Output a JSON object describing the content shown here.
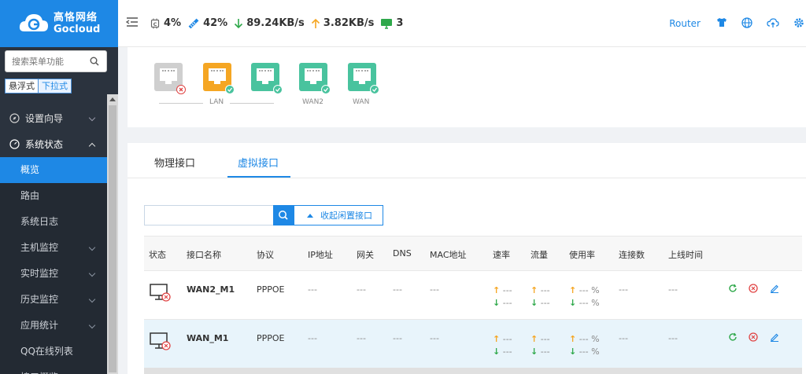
{
  "logo": {
    "cn": "高恪网络",
    "en": "Gocloud"
  },
  "sidebar": {
    "search_placeholder": "搜索菜单功能",
    "mode_floating": "悬浮式",
    "mode_dropdown": "下拉式",
    "items": [
      {
        "label": "设置向导"
      },
      {
        "label": "系统状态"
      }
    ],
    "subitems": [
      {
        "label": "概览"
      },
      {
        "label": "路由"
      },
      {
        "label": "系统日志"
      },
      {
        "label": "主机监控"
      },
      {
        "label": "实时监控"
      },
      {
        "label": "历史监控"
      },
      {
        "label": "应用统计"
      },
      {
        "label": "QQ在线列表"
      },
      {
        "label": "接口概览"
      }
    ]
  },
  "topbar": {
    "cpu": "4%",
    "mem": "42%",
    "down": "89.24KB/s",
    "up": "3.82KB/s",
    "clients": "3",
    "router_label": "Router"
  },
  "ports": {
    "lan_label": "LAN",
    "wan2_label": "WAN2",
    "wan_label": "WAN"
  },
  "tabs": {
    "physical": "物理接口",
    "virtual": "虚拟接口"
  },
  "filter": {
    "collapse_label": "收起闲置接口"
  },
  "table": {
    "headers": [
      "状态",
      "接口名称",
      "协议",
      "IP地址",
      "网关",
      "DNS",
      "MAC地址",
      "速率",
      "流量",
      "使用率",
      "连接数",
      "上线时间"
    ],
    "rows": [
      {
        "name": "WAN2_M1",
        "protocol": "PPPOE",
        "ip": "---",
        "gateway": "---",
        "dns": "---",
        "mac": "---",
        "rate_up": "---",
        "rate_down": "---",
        "traffic_up": "---",
        "traffic_down": "---",
        "usage_up": "--- %",
        "usage_down": "--- %",
        "conns": "---",
        "online": "---"
      },
      {
        "name": "WAN_M1",
        "protocol": "PPPOE",
        "ip": "---",
        "gateway": "---",
        "dns": "---",
        "mac": "---",
        "rate_up": "---",
        "rate_down": "---",
        "traffic_up": "---",
        "traffic_down": "---",
        "usage_up": "--- %",
        "usage_down": "--- %",
        "conns": "---",
        "online": "---"
      }
    ]
  },
  "colors": {
    "accent": "#1e88e5",
    "sidebar": "#2b333e",
    "port_green": "#49c39e",
    "port_orange": "#f5a623",
    "error": "#e04343"
  }
}
